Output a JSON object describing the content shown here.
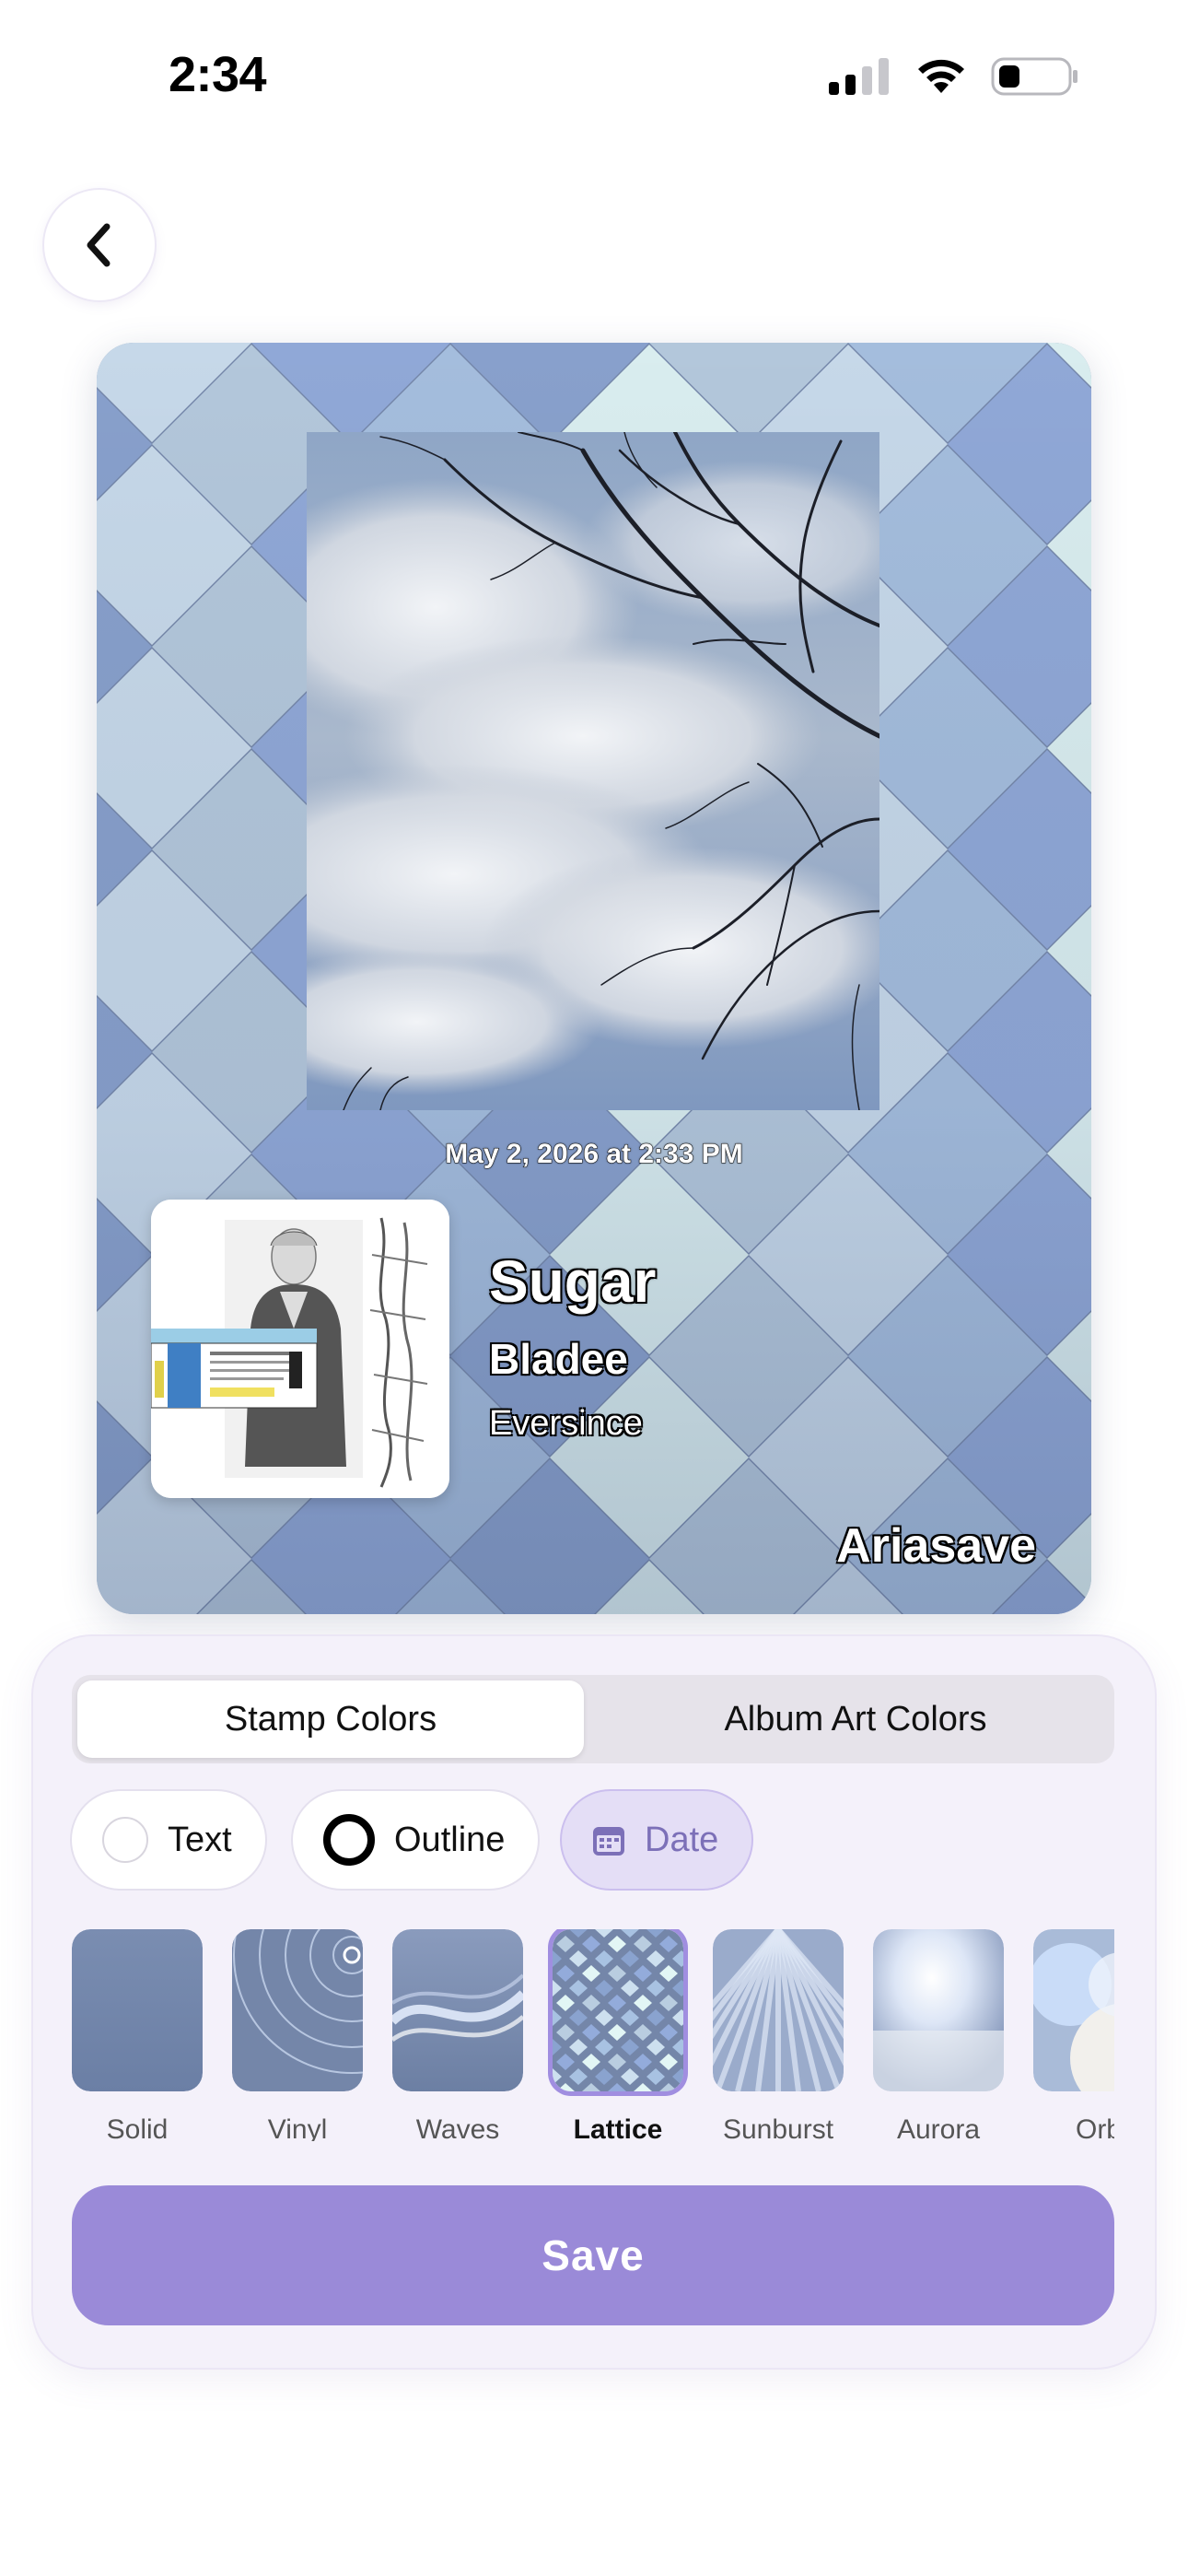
{
  "status_bar": {
    "time": "2:34",
    "icons": [
      "signal-icon",
      "wifi-icon",
      "battery-icon"
    ]
  },
  "navigation": {
    "back_icon": "chevron-left-icon"
  },
  "stamp": {
    "background_style": "lattice",
    "date": "May 2, 2026 at 2:33 PM",
    "song_title": "Sugar",
    "artist": "Bladee",
    "album": "Eversince",
    "brand": "Ariasave",
    "colors": {
      "dark": "#7385a8",
      "mid": "#93abdb",
      "light": "#cde0ef",
      "pale": "#e2f6f5"
    }
  },
  "panel": {
    "tabs": [
      {
        "label": "Stamp Colors",
        "selected": true
      },
      {
        "label": "Album Art Colors",
        "selected": false
      }
    ],
    "chips": [
      {
        "label": "Text",
        "icon": "empty-circle-icon",
        "active": false
      },
      {
        "label": "Outline",
        "icon": "ring-icon",
        "active": false
      },
      {
        "label": "Date",
        "icon": "calendar-icon",
        "active": true
      }
    ],
    "presets": [
      {
        "label": "Solid",
        "selected": false
      },
      {
        "label": "Vinyl",
        "selected": false
      },
      {
        "label": "Waves",
        "selected": false
      },
      {
        "label": "Lattice",
        "selected": true
      },
      {
        "label": "Sunburst",
        "selected": false
      },
      {
        "label": "Aurora",
        "selected": false
      },
      {
        "label": "Orb",
        "selected": false
      }
    ],
    "save_label": "Save",
    "accent": "#9a8ad8"
  }
}
